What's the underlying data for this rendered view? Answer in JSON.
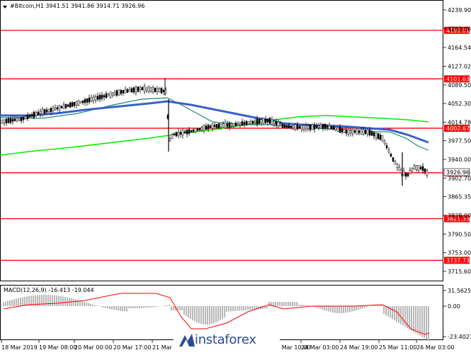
{
  "chart": {
    "header_text": "#Bitcoin,H1  3941.51 3941.86 3914.71 3926.96",
    "current_price": "3926.96",
    "price_ticks": [
      "4239.90",
      "4202.06",
      "4164.54",
      "4127.02",
      "4089.50",
      "4052.30",
      "4014.78",
      "3977.50",
      "3940.00",
      "3902.70",
      "3865.35",
      "3828.00",
      "3790.50",
      "3753.00",
      "3715.60"
    ],
    "levels": [
      {
        "value": 4199.01,
        "label": "4199.01"
      },
      {
        "value": 4101.63,
        "label": "4101.63"
      },
      {
        "value": 4002.67,
        "label": "4002.67"
      },
      {
        "value": 3913.4,
        "label": "3913.40"
      },
      {
        "value": 3821.33,
        "label": "3821.33"
      },
      {
        "value": 3737.73,
        "label": "3737.73"
      }
    ],
    "date_labels": [
      "18 Mar 2019",
      "19 Mar 08:00",
      "20 Mar 00:00",
      "20 Mar 17:00",
      "21 Mar 09:00",
      "22 Mar 02:00",
      "22 Mar 17:00",
      "23 Mar 10:00",
      "24 Mar 03:00",
      "24 Mar 19:00",
      "25 Mar 11:00",
      "26 Mar 03:00"
    ],
    "colors": {
      "level_line": "#ff0000",
      "ma_fast": "#1f8b74",
      "ma_mid": "#3a61c9",
      "ma_slow": "#00ee00",
      "macd_line": "#ff0000",
      "macd_hist": "#b8b8b8",
      "candle": "#000000"
    }
  },
  "macd": {
    "label": "MACD(12,26,9) -16.413 -19.044",
    "ticks": [
      "31.5625",
      "0.00",
      "-23.4027"
    ]
  },
  "watermark": {
    "text": "instaforex"
  }
}
